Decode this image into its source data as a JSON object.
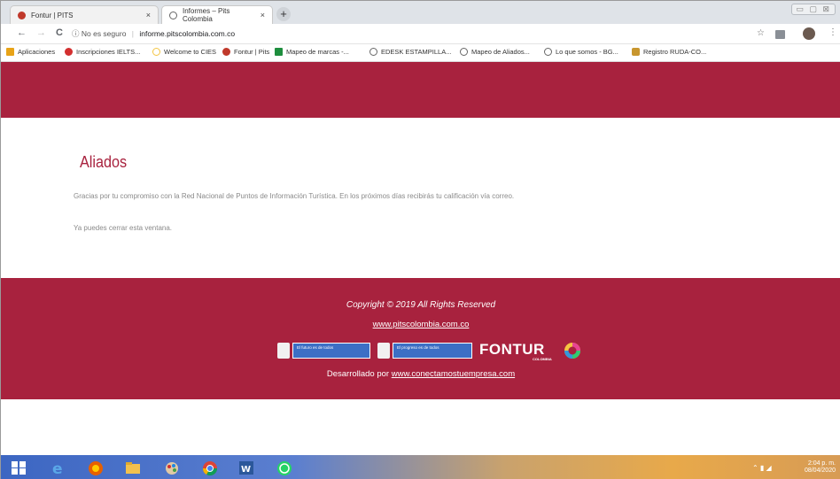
{
  "browser": {
    "tabs": [
      {
        "label": "Fontur | PITS",
        "close": "×",
        "favicon_color": "#c0392b"
      },
      {
        "label": "Informes – Pits Colombia",
        "close": "×",
        "favicon_color": "#666666"
      }
    ],
    "new_tab": "+",
    "nav": {
      "back": "←",
      "forward": "→",
      "reload": "C"
    },
    "address": {
      "security": "ⓘ No es seguro",
      "separator": "|",
      "url": "informe.pitscolombia.com.co"
    },
    "bookmarks": [
      {
        "label": "Aplicaciones",
        "icon": "apps-grid-icon",
        "color": "#e8a317"
      },
      {
        "label": "Inscripciones IELTS...",
        "icon": "ielts-icon",
        "color": "#d32f2f"
      },
      {
        "label": "Welcome to CIES",
        "icon": "cies-icon",
        "color": "#f4c542"
      },
      {
        "label": "Fontur | Pits",
        "icon": "fontur-icon",
        "color": "#c0392b"
      },
      {
        "label": "Mapeo de marcas -...",
        "icon": "sheets-icon",
        "color": "#1e8e3e"
      },
      {
        "label": "EDESK ESTAMPILLA...",
        "icon": "globe-icon",
        "color": "#666666"
      },
      {
        "label": "Mapeo de Aliados...",
        "icon": "globe-icon",
        "color": "#666666"
      },
      {
        "label": "Lo que somos - BG...",
        "icon": "globe-icon",
        "color": "#666666"
      },
      {
        "label": "Registro RUDA-CO...",
        "icon": "person-icon",
        "color": "#c8962e"
      }
    ]
  },
  "page": {
    "title": "Aliados",
    "message_1": "Gracias por tu compromiso con la Red Nacional de Puntos de Información Turística. En los próximos días recibirás tu calificación vía correo.",
    "message_2": "Ya puedes cerrar esta ventana.",
    "footer": {
      "copyright": "Copyright © 2019 All Rights Reserved",
      "site_link": "www.pitscolombia.com.co",
      "logo_1_text": "El futuro es de todos",
      "logo_2_text": "El progreso es de todos",
      "fontur_text": "FONTUR",
      "fontur_sub": "COLOMBIA",
      "developed_by_label": "Desarrollado por",
      "developed_by_link": "www.conectamostuempresa.com"
    }
  },
  "colors": {
    "brand": "#a8223e"
  },
  "taskbar": {
    "time": "2:04 p. m.",
    "date": "08/04/2020"
  }
}
